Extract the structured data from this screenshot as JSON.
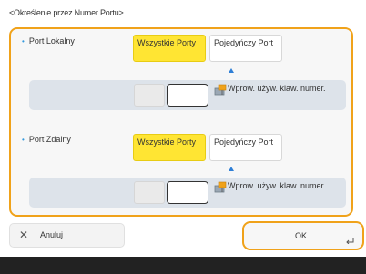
{
  "header": {
    "title": "<Określenie przez Numer Portu>"
  },
  "local_port": {
    "label": "Port Lokalny",
    "options": [
      {
        "label": "Wszystkie Porty",
        "selected": true
      },
      {
        "label": "Pojedyńczy Port",
        "selected": false
      }
    ],
    "input_value": "",
    "keyboard_label": "Wprow. używ. klaw. numer."
  },
  "remote_port": {
    "label": "Port Zdalny",
    "options": [
      {
        "label": "Wszystkie Porty",
        "selected": true
      },
      {
        "label": "Pojedyńczy Port",
        "selected": false
      }
    ],
    "input_value": "",
    "keyboard_label": "Wprow. używ. klaw. numer."
  },
  "buttons": {
    "cancel": "Anuluj",
    "ok": "OK"
  },
  "colors": {
    "accent": "#f0a21a",
    "selected": "#ffe533",
    "arrow": "#2f7fd6"
  }
}
